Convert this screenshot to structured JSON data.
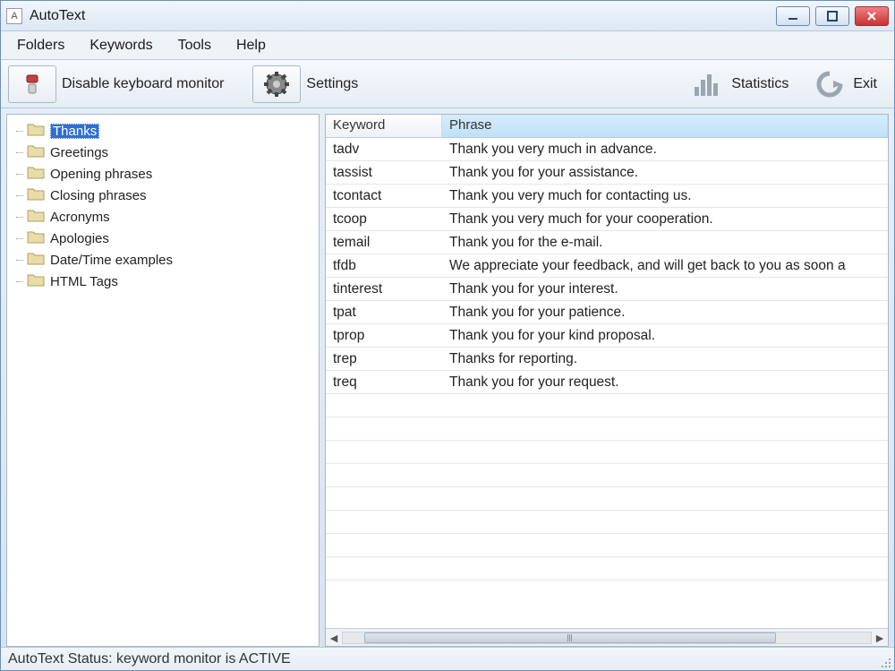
{
  "title": "AutoText",
  "app_icon_letter": "A",
  "menu": {
    "folders": "Folders",
    "keywords": "Keywords",
    "tools": "Tools",
    "help": "Help"
  },
  "toolbar": {
    "disable_monitor": "Disable keyboard monitor",
    "settings": "Settings",
    "statistics": "Statistics",
    "exit": "Exit"
  },
  "tree": {
    "items": [
      {
        "label": "Thanks",
        "selected": true
      },
      {
        "label": "Greetings"
      },
      {
        "label": "Opening phrases"
      },
      {
        "label": "Closing phrases"
      },
      {
        "label": "Acronyms"
      },
      {
        "label": "Apologies"
      },
      {
        "label": "Date/Time examples"
      },
      {
        "label": "HTML Tags"
      }
    ]
  },
  "grid": {
    "headers": {
      "keyword": "Keyword",
      "phrase": "Phrase"
    },
    "rows": [
      {
        "k": "tadv",
        "p": "Thank you very much in advance."
      },
      {
        "k": "tassist",
        "p": "Thank you for your assistance."
      },
      {
        "k": "tcontact",
        "p": "Thank you very much for contacting us."
      },
      {
        "k": "tcoop",
        "p": "Thank you very much for your cooperation."
      },
      {
        "k": "temail",
        "p": "Thank you for the e-mail."
      },
      {
        "k": "tfdb",
        "p": "We appreciate your feedback, and will get back to you as soon a"
      },
      {
        "k": "tinterest",
        "p": "Thank you for your interest."
      },
      {
        "k": "tpat",
        "p": "Thank you for your patience."
      },
      {
        "k": "tprop",
        "p": "Thank you for your kind proposal."
      },
      {
        "k": "trep",
        "p": "Thanks for reporting."
      },
      {
        "k": "treq",
        "p": "Thank you for your request."
      }
    ]
  },
  "status": "AutoText Status: keyword monitor is ACTIVE"
}
